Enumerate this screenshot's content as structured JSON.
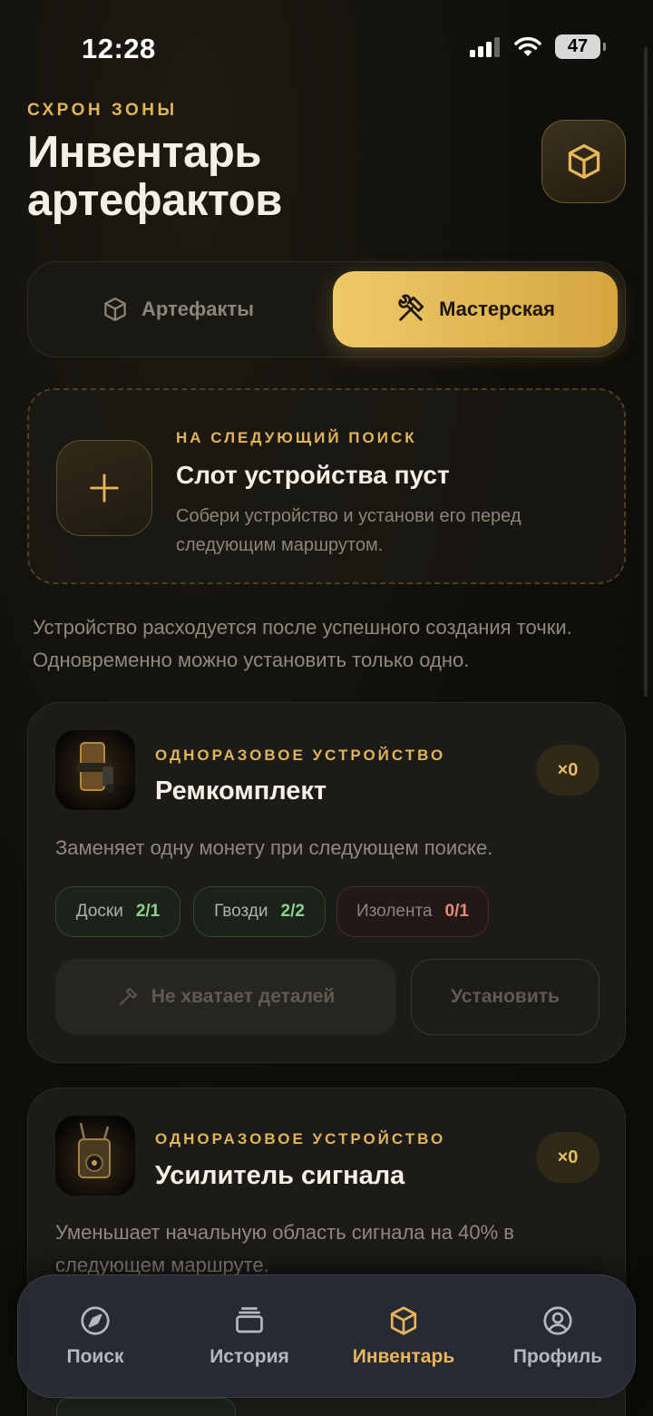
{
  "status_bar": {
    "time": "12:28",
    "battery": "47"
  },
  "header": {
    "eyebrow": "СХРОН ЗОНЫ",
    "title": "Инвентарь артефактов"
  },
  "tabs": [
    {
      "label": "Артефакты",
      "active": false
    },
    {
      "label": "Мастерская",
      "active": true
    }
  ],
  "slot": {
    "eyebrow": "НА СЛЕДУЮЩИЙ ПОИСК",
    "title": "Слот устройства пуст",
    "description": "Собери устройство и установи его перед следующим маршрутом."
  },
  "info_text": "Устройство расходуется после успешного создания точки. Одновременно можно установить только одно.",
  "devices": [
    {
      "type_label": "ОДНОРАЗОВОЕ УСТРОЙСТВО",
      "name": "Ремкомплект",
      "count": "×0",
      "description": "Заменяет одну монету при следующем поиске.",
      "materials": [
        {
          "name": "Доски",
          "value": "2/1",
          "status": "ok"
        },
        {
          "name": "Гвозди",
          "value": "2/2",
          "status": "ok"
        },
        {
          "name": "Изолента",
          "value": "0/1",
          "status": "missing"
        }
      ],
      "craft_label": "Не хватает деталей",
      "install_label": "Установить"
    },
    {
      "type_label": "ОДНОРАЗОВОЕ УСТРОЙСТВО",
      "name": "Усилитель сигнала",
      "count": "×0",
      "description": "Уменьшает начальную область сигнала на 40% в следующем маршруте."
    }
  ],
  "bottom_nav": [
    {
      "label": "Поиск",
      "icon": "compass-icon",
      "active": false
    },
    {
      "label": "История",
      "icon": "stack-icon",
      "active": false
    },
    {
      "label": "Инвентарь",
      "icon": "cube-icon",
      "active": true
    },
    {
      "label": "Профиль",
      "icon": "profile-icon",
      "active": false
    }
  ],
  "colors": {
    "accent": "#e2b45a",
    "background": "#0f0e0a",
    "ok": "#8fd08a",
    "missing": "#e38a7a"
  }
}
